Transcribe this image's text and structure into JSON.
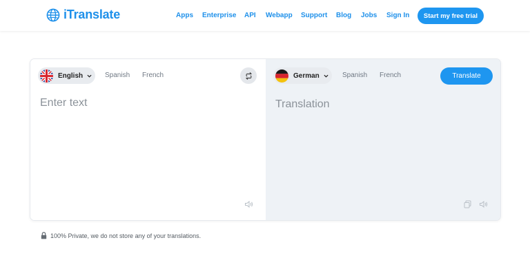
{
  "brand": {
    "name": "iTranslate",
    "icon": "globe-icon",
    "color": "#1e90ea"
  },
  "nav": {
    "links": [
      "Apps",
      "Enterprise",
      "API",
      "Webapp",
      "Support",
      "Blog",
      "Jobs",
      "Sign In"
    ],
    "cta": "Start my free trial"
  },
  "source": {
    "selected_language": "English",
    "flag": "uk-flag-icon",
    "alternatives": [
      "Spanish",
      "French"
    ],
    "placeholder": "Enter text",
    "value": ""
  },
  "target": {
    "selected_language": "German",
    "flag": "germany-flag-icon",
    "alternatives": [
      "Spanish",
      "French"
    ],
    "placeholder": "Translation",
    "button": "Translate"
  },
  "privacy": {
    "text": "100% Private, we do not store any of your translations."
  },
  "colors": {
    "accent": "#1e96f0",
    "pill": "#e8ebef",
    "output_bg": "#eef2f6"
  }
}
